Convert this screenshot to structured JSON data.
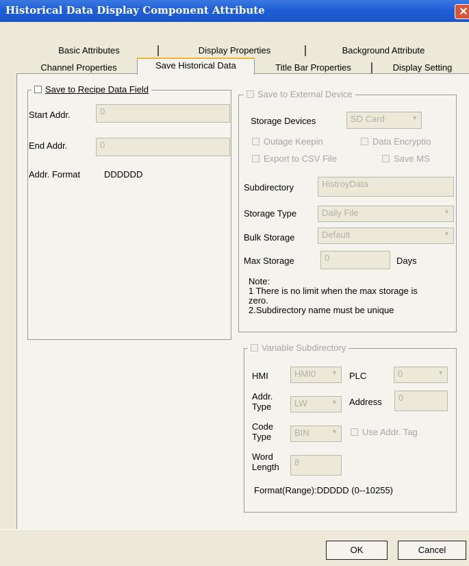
{
  "window": {
    "title": "Historical Data Display Component Attribute",
    "close_glyph": "✕"
  },
  "tabs": {
    "row1": [
      "Basic Attributes",
      "Display Properties",
      "Background Attribute"
    ],
    "row2": [
      "Channel Properties",
      "Save Historical Data",
      "Title Bar Properties",
      "Display Setting"
    ],
    "selected": "Save Historical Data"
  },
  "recipe": {
    "checkbox_label": "Save to Recipe Data Field",
    "start_addr_label": "Start Addr.",
    "start_addr_value": "0",
    "end_addr_label": "End Addr.",
    "end_addr_value": "0",
    "addr_format_label": "Addr. Format",
    "addr_format_value": "DDDDDD"
  },
  "external": {
    "checkbox_label": "Save to External Device",
    "storage_devices_label": "Storage Devices",
    "storage_devices_value": "SD Card",
    "outage_keepin": "Outage Keepin",
    "data_encryption": "Data Encryptio",
    "export_csv": "Export to CSV File",
    "save_ms": "Save MS",
    "subdirectory_label": "Subdirectory",
    "subdirectory_value": "HistroyData",
    "storage_type_label": "Storage Type",
    "storage_type_value": "Daily File",
    "bulk_storage_label": "Bulk Storage",
    "bulk_storage_value": "Default",
    "max_storage_label": "Max Storage",
    "max_storage_value": "0",
    "max_storage_unit": "Days",
    "note": {
      "line1": "Note:",
      "line2": "1 There is no limit when the max storage is",
      "line3": "zero.",
      "line4": "2.Subdirectory name must be unique"
    }
  },
  "variable": {
    "checkbox_label": "Variable Subdirectory",
    "hmi_label": "HMI",
    "hmi_value": "HMI0",
    "plc_label": "PLC",
    "plc_value": "0",
    "addr_type_label1": "Addr.",
    "addr_type_label2": "Type",
    "addr_type_value": "LW",
    "address_label": "Address",
    "address_value": "0",
    "code_type_label1": "Code",
    "code_type_label2": "Type",
    "code_type_value": "BIN",
    "use_addr_tag": "Use Addr. Tag",
    "word_length_label1": "Word",
    "word_length_label2": "Length",
    "word_length_value": "8",
    "format_range": "Format(Range):DDDDD (0--10255)"
  },
  "buttons": {
    "ok": "OK",
    "cancel": "Cancel"
  },
  "colors": {
    "titlebar": "#1f5fd6",
    "tab_highlight": "#f6b33a",
    "dialog_bg": "#ece9d8",
    "close": "#d8553a"
  }
}
